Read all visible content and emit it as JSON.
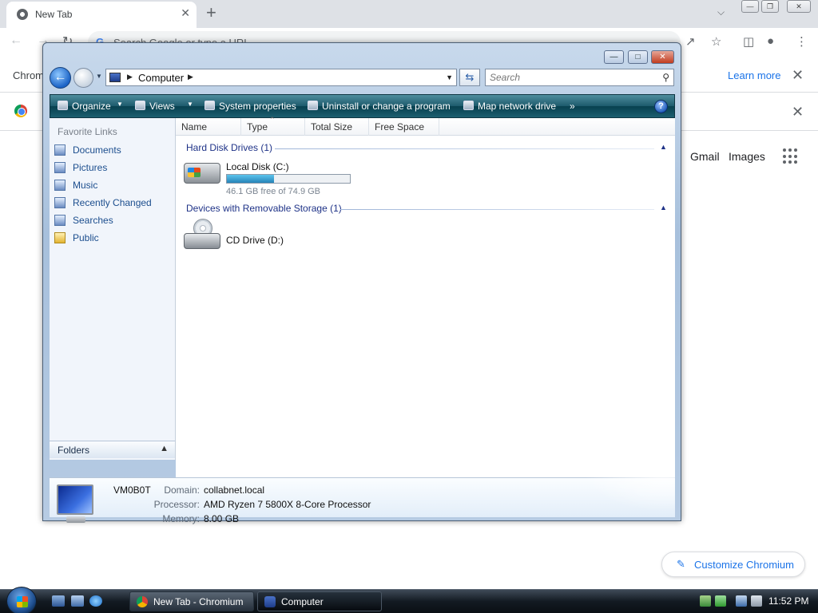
{
  "browser": {
    "tab_title": "New Tab",
    "tab_close": "✕",
    "new_tab": "+",
    "omnibox_placeholder": "Search Google or type a URL",
    "infobar_text": "Chrom",
    "learn_more": "Learn more",
    "close_glyph": "✕",
    "shortcuts": [
      "Gmail",
      "Images"
    ],
    "customize": "Customize Chromium"
  },
  "explorer": {
    "breadcrumb": "Computer",
    "search_placeholder": "Search",
    "commands": [
      {
        "label": "Organize",
        "has_dropdown": true
      },
      {
        "label": "Views",
        "has_dropdown": true
      },
      {
        "label": "System properties"
      },
      {
        "label": "Uninstall or change a program"
      },
      {
        "label": "Map network drive"
      }
    ],
    "more_commands": "»",
    "help": "?",
    "favorite_links_heading": "Favorite Links",
    "favorite_links": [
      "Documents",
      "Pictures",
      "Music",
      "Recently Changed",
      "Searches",
      "Public"
    ],
    "folders_label": "Folders",
    "columns": [
      "Name",
      "Type",
      "Total Size",
      "Free Space"
    ],
    "groups": [
      {
        "title": "Hard Disk Drives (1)",
        "drives": [
          {
            "name": "Local Disk (C:)",
            "free_text": "46.1 GB free of 74.9 GB",
            "used_fraction": 0.385
          }
        ]
      },
      {
        "title": "Devices with Removable Storage (1)",
        "drives": [
          {
            "name": "CD Drive (D:)"
          }
        ]
      }
    ],
    "details": {
      "computer_name": "VM0B0T",
      "domain_label": "Domain:",
      "domain": "collabnet.local",
      "processor_label": "Processor:",
      "processor": "AMD Ryzen 7 5800X 8-Core Processor",
      "memory_label": "Memory:",
      "memory": "8.00 GB"
    }
  },
  "taskbar": {
    "items": [
      {
        "label": "New Tab - Chromium",
        "active": false
      },
      {
        "label": "Computer",
        "active": true
      }
    ],
    "clock": "11:52 PM"
  }
}
